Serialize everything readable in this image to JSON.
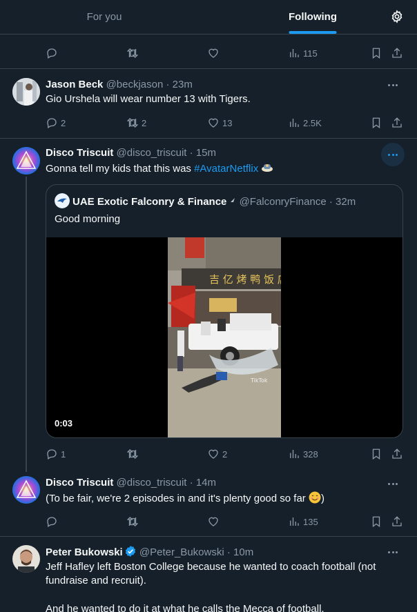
{
  "tabs": [
    {
      "label": "For you",
      "active": false
    },
    {
      "label": "Following",
      "active": true
    }
  ],
  "top_tweet_actions": {
    "views": "115"
  },
  "tweets": [
    {
      "name": "Jason Beck",
      "handle": "@beckjason",
      "time": "· 23m",
      "text": "Gio Urshela will wear number 13 with Tigers.",
      "replies": "2",
      "retweets": "2",
      "likes": "13",
      "views": "2.5K"
    },
    {
      "name": "Disco Triscuit",
      "handle": "@disco_triscuit",
      "time": "· 15m",
      "text": "Gonna tell my kids that this was ",
      "hashtag": "#AvatarNetflix",
      "quote": {
        "name": "UAE Exotic Falconry & Finance",
        "handle": "@FalconryFinance",
        "time": "· 32m",
        "text": "Good morning",
        "video_duration": "0:03",
        "watermark": "TikTok"
      },
      "replies": "1",
      "likes": "2",
      "views": "328"
    },
    {
      "name": "Disco Triscuit",
      "handle": "@disco_triscuit",
      "time": "· 14m",
      "text": "(To be fair, we're 2 episodes in and it's plenty good so far",
      "text_end": ")",
      "views": "135"
    },
    {
      "name": "Peter Bukowski",
      "handle": "@Peter_Bukowski",
      "time": "· 10m",
      "text": "Jeff Hafley left Boston College because he wanted to coach football (not fundraise and recruit).",
      "text2": "And he wanted to do it at what he calls the Mecca of football."
    }
  ],
  "colors": {
    "accent": "#1d9bf0",
    "bg": "#15202b",
    "border": "#38444d",
    "muted": "#8b98a5"
  },
  "icons": [
    "settings-gear-icon",
    "reply-icon",
    "retweet-icon",
    "like-icon",
    "views-icon",
    "bookmark-icon",
    "share-icon",
    "more-icon",
    "verified-badge-icon"
  ]
}
